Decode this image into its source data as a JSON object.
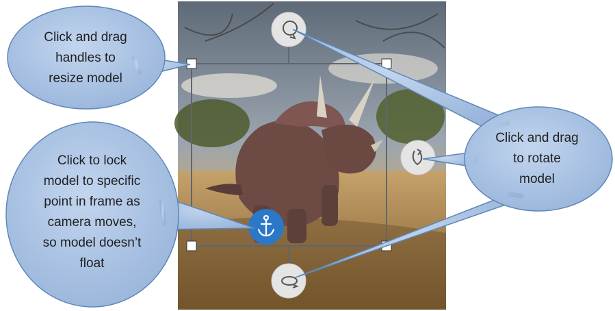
{
  "scene": {
    "icons": {
      "rotate_top": "rotate-top-icon",
      "rotate_side": "rotate-side-icon",
      "rotate_bottom": "rotate-bottom-icon",
      "anchor": "anchor-icon"
    },
    "colors": {
      "anchor_button": "#2b78c8",
      "rotate_handle": "#e4e4e4",
      "callout_fill": "#a9c3e3",
      "callout_stroke": "#5f87b7",
      "bounding_box": "#5f6670"
    }
  },
  "callouts": {
    "resize": "Click and drag\nhandles to\nresize model",
    "lock": "Click to lock\nmodel to specific\npoint in frame as\ncamera moves,\nso model doesn’t\nfloat",
    "rotate": "Click and drag\nto rotate\nmodel"
  }
}
